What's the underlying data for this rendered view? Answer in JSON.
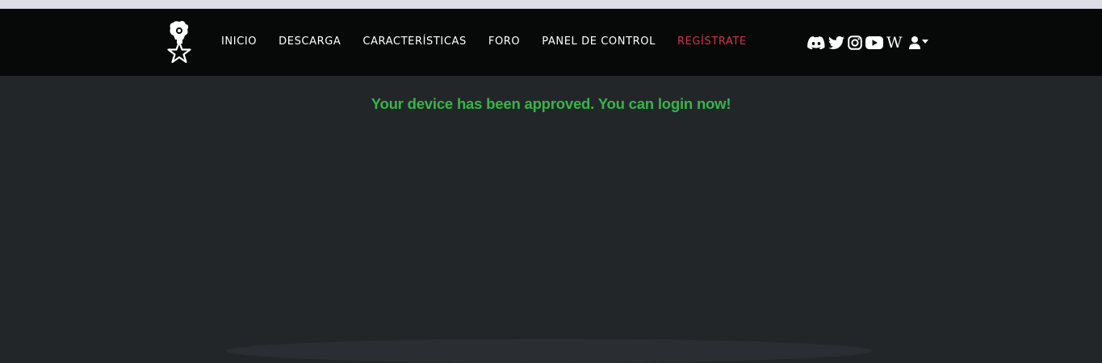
{
  "nav": {
    "links": [
      {
        "label": "INICIO"
      },
      {
        "label": "DESCARGA"
      },
      {
        "label": "CARACTERÍSTICAS"
      },
      {
        "label": "FORO"
      },
      {
        "label": "PANEL DE CONTROL"
      },
      {
        "label": "REGÍSTRATE",
        "color": "#d2334d"
      }
    ],
    "social_icons": [
      "discord-icon",
      "twitter-icon",
      "instagram-icon",
      "youtube-icon",
      "wikipedia-icon",
      "user-dropdown-icon"
    ],
    "wiki_glyph": "W"
  },
  "main": {
    "message": "Your device has been approved. You can login now!",
    "message_color": "#36b54a"
  },
  "colors": {
    "navbar_bg": "#070808",
    "page_bg": "#232629",
    "accent": "#d2334d"
  }
}
